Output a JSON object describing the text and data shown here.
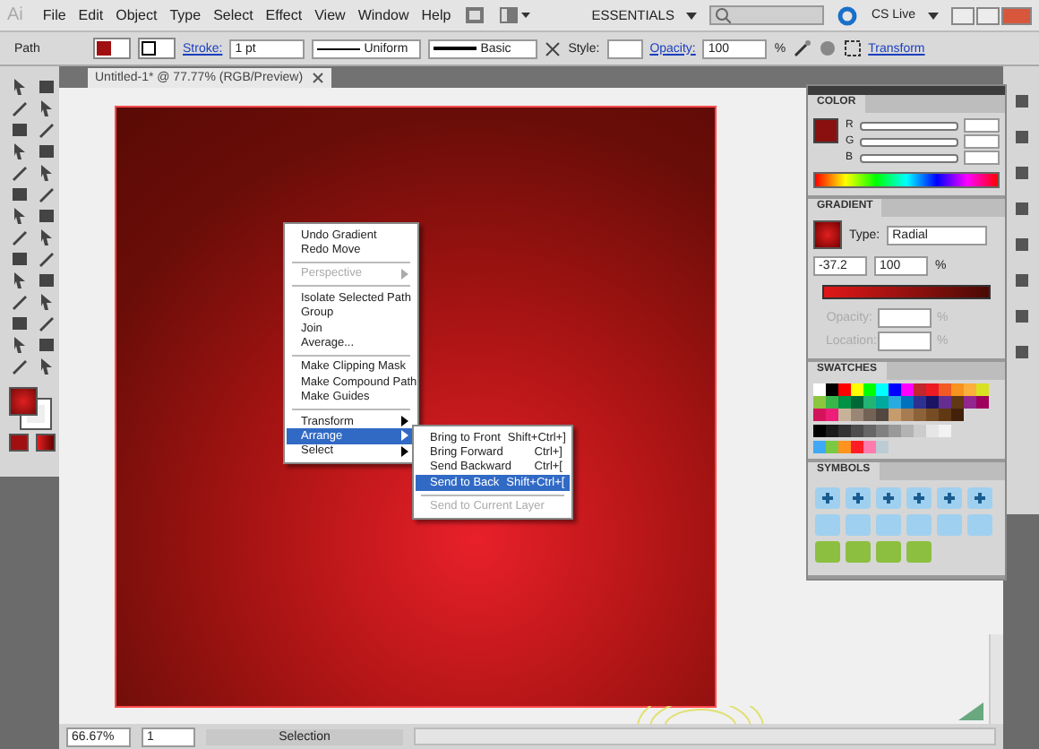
{
  "menu_bar": {
    "logo": "Ai",
    "items": [
      "File",
      "Edit",
      "Object",
      "Type",
      "Select",
      "Effect",
      "View",
      "Window",
      "Help"
    ],
    "workspace": "ESSENTIALS",
    "cs_live": "CS Live"
  },
  "control_bar": {
    "selection": "Path",
    "stroke_label": "Stroke:",
    "stroke_weight": "1 pt",
    "profile": "Uniform",
    "brush": "Basic",
    "style_label": "Style:",
    "opacity_label": "Opacity:",
    "opacity": "100",
    "percent": "%",
    "transform": "Transform"
  },
  "document_tab": {
    "title": "Untitled-1* @ 77.77% (RGB/Preview)"
  },
  "context_menu": {
    "groups": [
      [
        {
          "label": "Undo Gradient",
          "disabled": false,
          "selected": false,
          "submenu": false
        },
        {
          "label": "Redo Move",
          "disabled": false,
          "selected": false,
          "submenu": false
        }
      ],
      [
        {
          "label": "Perspective",
          "disabled": true,
          "selected": false,
          "submenu": true
        }
      ],
      [
        {
          "label": "Isolate Selected Path",
          "disabled": false,
          "selected": false,
          "submenu": false
        },
        {
          "label": "Group",
          "disabled": false,
          "selected": false,
          "submenu": false
        },
        {
          "label": "Join",
          "disabled": false,
          "selected": false,
          "submenu": false
        },
        {
          "label": "Average...",
          "disabled": false,
          "selected": false,
          "submenu": false
        }
      ],
      [
        {
          "label": "Make Clipping Mask",
          "disabled": false,
          "selected": false,
          "submenu": false
        },
        {
          "label": "Make Compound Path",
          "disabled": false,
          "selected": false,
          "submenu": false
        },
        {
          "label": "Make Guides",
          "disabled": false,
          "selected": false,
          "submenu": false
        }
      ],
      [
        {
          "label": "Transform",
          "disabled": false,
          "selected": false,
          "submenu": true
        },
        {
          "label": "Arrange",
          "disabled": false,
          "selected": true,
          "submenu": true
        },
        {
          "label": "Select",
          "disabled": false,
          "selected": false,
          "submenu": true
        }
      ]
    ]
  },
  "submenu": {
    "groups": [
      [
        {
          "label": "Bring to Front",
          "shortcut": "Shift+Ctrl+]",
          "disabled": false,
          "selected": false
        },
        {
          "label": "Bring Forward",
          "shortcut": "Ctrl+]",
          "disabled": false,
          "selected": false
        },
        {
          "label": "Send Backward",
          "shortcut": "Ctrl+[",
          "disabled": false,
          "selected": false
        },
        {
          "label": "Send to Back",
          "shortcut": "Shift+Ctrl+[",
          "disabled": false,
          "selected": true
        }
      ],
      [
        {
          "label": "Send to Current Layer",
          "disabled": true,
          "selected": false
        }
      ]
    ]
  },
  "color_panel": {
    "title": "COLOR",
    "channels": [
      "R",
      "G",
      "B"
    ]
  },
  "gradient_panel": {
    "title": "GRADIENT",
    "type_label": "Type:",
    "type": "Radial",
    "angle": "-37.2",
    "aspect": "100",
    "percent": "%",
    "fields": [
      {
        "label": "Opacity:",
        "percent": "%",
        "disabled": true
      },
      {
        "label": "Location:",
        "percent": "%",
        "disabled": true
      }
    ]
  },
  "swatches_panel": {
    "title": "SWATCHES",
    "groups": [
      [
        {
          "color": "#ffffff"
        },
        {
          "color": "#000000"
        },
        {
          "color": "#ff0000"
        },
        {
          "color": "#ffff00"
        },
        {
          "color": "#00ff00"
        },
        {
          "color": "#00ffff"
        },
        {
          "color": "#0000ff"
        },
        {
          "color": "#ff00ff"
        },
        {
          "color": "#c1272d"
        },
        {
          "color": "#ed1c24"
        },
        {
          "color": "#f15a24"
        },
        {
          "color": "#f7931e"
        },
        {
          "color": "#fbb03b"
        },
        {
          "color": "#d9e021"
        },
        {
          "color": "#8cc63f"
        },
        {
          "color": "#39b54a"
        },
        {
          "color": "#009245"
        },
        {
          "color": "#006837"
        },
        {
          "color": "#22b573"
        },
        {
          "color": "#00a99d"
        },
        {
          "color": "#29abe2"
        },
        {
          "color": "#0071bc"
        },
        {
          "color": "#2e3192"
        },
        {
          "color": "#1b1464"
        },
        {
          "color": "#662d91"
        },
        {
          "color": "#603813"
        },
        {
          "color": "#93278f"
        },
        {
          "color": "#9e005d"
        },
        {
          "color": "#d4145a"
        },
        {
          "color": "#ed1e79"
        },
        {
          "color": "#c7b299"
        },
        {
          "color": "#998675"
        },
        {
          "color": "#736357"
        },
        {
          "color": "#534741"
        },
        {
          "color": "#c69c6d"
        },
        {
          "color": "#a67c52"
        },
        {
          "color": "#8c6239"
        },
        {
          "color": "#754c24"
        },
        {
          "color": "#603813"
        },
        {
          "color": "#42210b"
        }
      ],
      [
        {
          "color": "#000000"
        },
        {
          "color": "#1a1a1a"
        },
        {
          "color": "#333333"
        },
        {
          "color": "#4d4d4d"
        },
        {
          "color": "#666666"
        },
        {
          "color": "#808080"
        },
        {
          "color": "#999999"
        },
        {
          "color": "#b3b3b3"
        },
        {
          "color": "#cccccc"
        },
        {
          "color": "#e6e6e6"
        },
        {
          "color": "#f2f2f2"
        }
      ],
      [
        {
          "color": "#3fa9f5"
        },
        {
          "color": "#7ac943"
        },
        {
          "color": "#ff931e"
        },
        {
          "color": "#ff1d25"
        },
        {
          "color": "#ff7bac"
        },
        {
          "color": "#bdccd4"
        }
      ]
    ]
  },
  "symbols_panel": {
    "title": "SYMBOLS"
  },
  "status_bar": {
    "zoom": "66.67%",
    "page": "1",
    "tool": "Selection"
  }
}
